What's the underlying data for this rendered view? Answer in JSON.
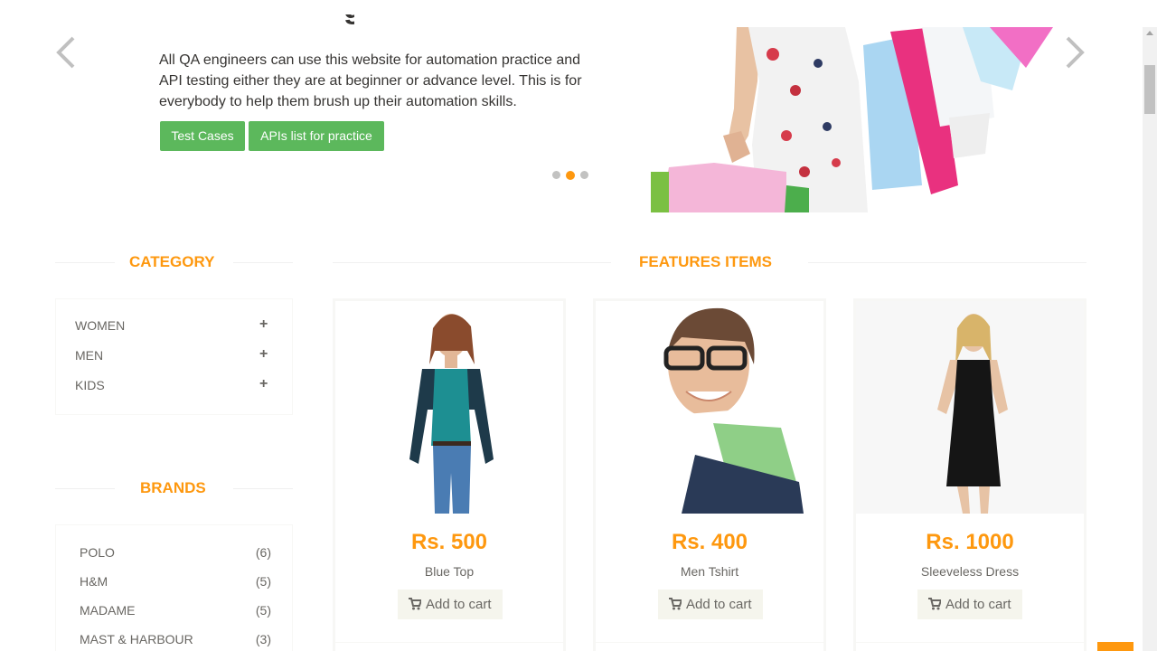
{
  "slider": {
    "description": "All QA engineers can use this website for automation practice and API testing either they are at beginner or advance level. This is for everybody to help them brush up their automation skills.",
    "buttons": {
      "test_cases": "Test Cases",
      "apis_list": "APIs list for practice"
    },
    "dots": 3,
    "active_dot": 2
  },
  "category": {
    "title": "Category",
    "items": [
      {
        "label": "Women"
      },
      {
        "label": "Men"
      },
      {
        "label": "Kids"
      }
    ],
    "expand_symbol": "+"
  },
  "brands": {
    "title": "Brands",
    "items": [
      {
        "label": "Polo",
        "count": "(6)"
      },
      {
        "label": "H&M",
        "count": "(5)"
      },
      {
        "label": "Madame",
        "count": "(5)"
      },
      {
        "label": "Mast & Harbour",
        "count": "(3)"
      }
    ]
  },
  "features": {
    "title": "Features Items",
    "products": [
      {
        "price": "Rs. 500",
        "name": "Blue Top",
        "cart_label": "Add to cart"
      },
      {
        "price": "Rs. 400",
        "name": "Men Tshirt",
        "cart_label": "Add to cart"
      },
      {
        "price": "Rs. 1000",
        "name": "Sleeveless Dress",
        "cart_label": "Add to cart"
      }
    ]
  },
  "colors": {
    "accent": "#FE980F",
    "green": "#5cb85c",
    "text": "#696763"
  },
  "icons": [
    "chevron-left-icon",
    "chevron-right-icon",
    "plus-icon",
    "shopping-cart-icon"
  ]
}
